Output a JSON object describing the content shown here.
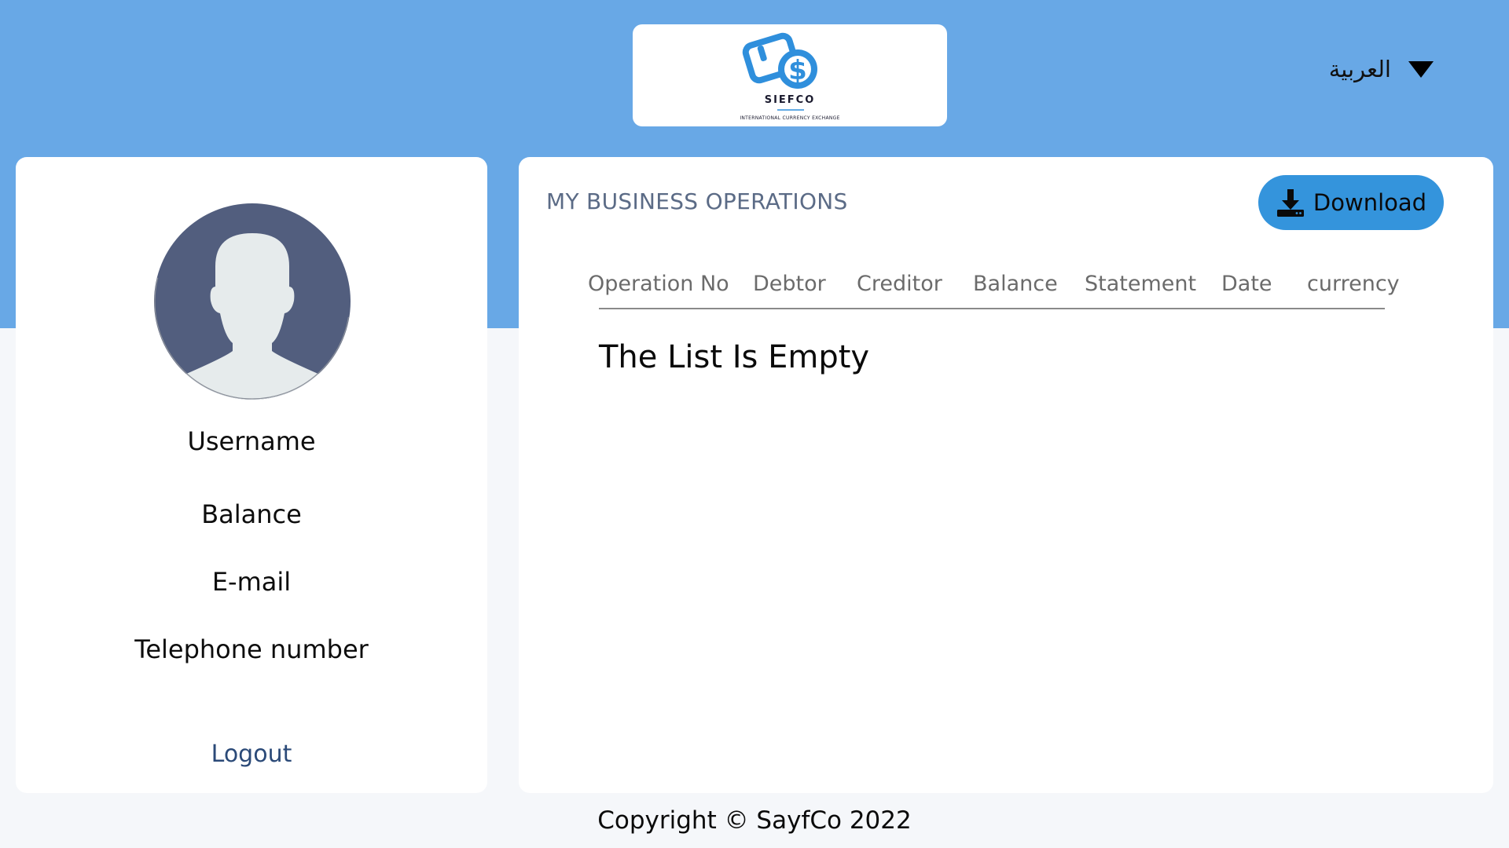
{
  "header": {
    "logo": {
      "name": "SIEFCO",
      "tagline": "INTERNATIONAL CURRENCY EXCHANGE"
    },
    "language_selector": {
      "selected": "العربية",
      "icon": "caret-down-icon"
    }
  },
  "profile": {
    "avatar_icon": "user-avatar-icon",
    "username_label": "Username",
    "balance_label": "Balance",
    "email_label": "E-mail",
    "telephone_label": "Telephone number",
    "logout_label": "Logout"
  },
  "operations": {
    "title": "MY BUSINESS OPERATIONS",
    "download_button": {
      "label": "Download",
      "icon": "download-icon"
    },
    "columns": [
      "Operation No",
      "Debtor",
      "Creditor",
      "Balance",
      "Statement",
      "Date",
      "currency"
    ],
    "empty_message": "The List Is Empty"
  },
  "footer": {
    "copyright": "Copyright © SayfCo 2022"
  },
  "colors": {
    "header_band": "#68a8e6",
    "accent_button": "#3494dc",
    "page_background": "#f5f7fa",
    "avatar_background": "#525e7e"
  }
}
